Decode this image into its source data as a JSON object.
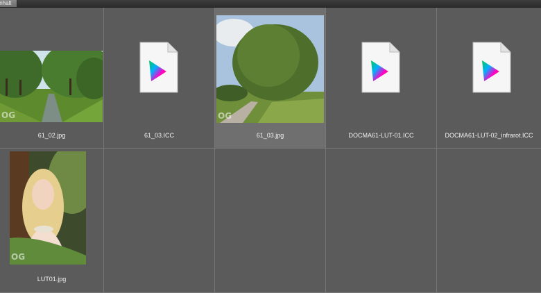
{
  "panel": {
    "tab_label": "Inhalt"
  },
  "files": [
    {
      "name": "61_02.jpg",
      "kind": "image",
      "subject": "canal-with-trees"
    },
    {
      "name": "61_03.ICC",
      "kind": "icc-profile",
      "icon": "icc-color-profile-icon"
    },
    {
      "name": "61_03.jpg",
      "kind": "image",
      "subject": "willow-tree-path"
    },
    {
      "name": "DOCMA61-LUT-01.ICC",
      "kind": "icc-profile",
      "icon": "icc-color-profile-icon"
    },
    {
      "name": "DOCMA61-LUT-02_infrarot.ICC",
      "kind": "icc-profile",
      "icon": "icc-color-profile-icon"
    },
    {
      "name": "LUT01.jpg",
      "kind": "image",
      "subject": "portrait-woman"
    }
  ],
  "watermark": "OG",
  "colors": {
    "panel_bg": "#5b5b5b",
    "selected_bg": "#6f6f6f",
    "grid_line": "#777777"
  }
}
